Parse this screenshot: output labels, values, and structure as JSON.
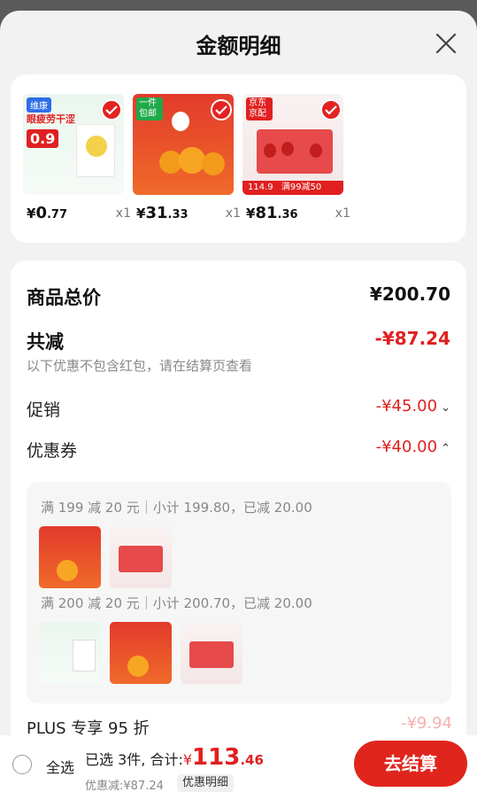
{
  "header": {
    "title": "金额明细"
  },
  "products": [
    {
      "price_yen": "¥",
      "price_int": "0",
      "price_dec": ".77",
      "qty": "x1",
      "tag": "维康",
      "caption": "眼疲劳干涩",
      "badge": "0.9"
    },
    {
      "price_yen": "¥",
      "price_int": "31",
      "price_dec": ".33",
      "qty": "x1",
      "tag": "一件包邮",
      "caption": "",
      "badge": ""
    },
    {
      "price_yen": "¥",
      "price_int": "81",
      "price_dec": ".36",
      "qty": "x1",
      "tag": "京东京配",
      "caption": "114.9",
      "badge": "满99减50"
    }
  ],
  "summary": {
    "goods_total_label": "商品总价",
    "goods_total_value": "¥200.70",
    "total_discount_label": "共减",
    "total_discount_value": "-¥87.24",
    "note": "以下优惠不包含红包，请在结算页查看",
    "promo_label": "促销",
    "promo_value": "-¥45.00",
    "coupon_label": "优惠券",
    "coupon_value": "-¥40.00",
    "coupon_rules": [
      {
        "text": "满 199 减 20 元｜小计 199.80，已减 20.00"
      },
      {
        "text": "满 200 减 20 元｜小计 200.70，已减 20.00"
      }
    ],
    "plus_label": "PLUS 专享 95 折",
    "plus_value": "-¥9.94"
  },
  "bottom": {
    "select_all": "全选",
    "selected_summary": "已选 3件, 合计:",
    "total_yen": "¥",
    "total_int": "113",
    "total_dec": ".46",
    "discount_line": "优惠减:¥87.24",
    "detail_button": "优惠明细",
    "checkout_button": "去结算"
  },
  "colors": {
    "accent": "#e02020",
    "sheet_bg": "#f2f2f2"
  },
  "icons": {
    "close": "close-icon",
    "check": "check-icon",
    "chevron_down": "chevron-down-icon",
    "chevron_up": "chevron-up-icon"
  }
}
